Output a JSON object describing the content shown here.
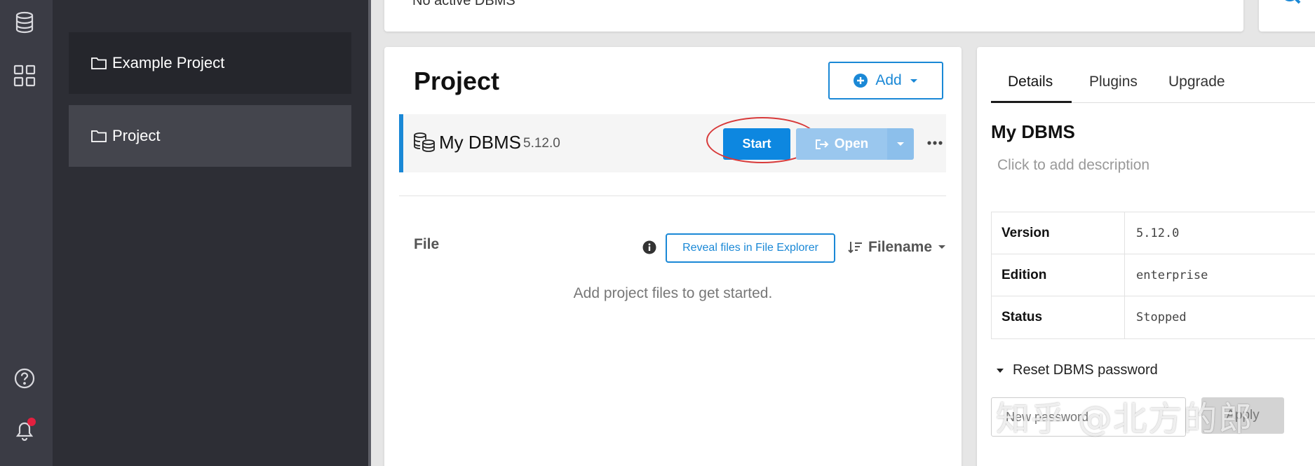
{
  "topbar": {
    "partial_text": "No active DBMS"
  },
  "sidebar": {
    "projects": [
      {
        "label": "Example Project"
      },
      {
        "label": "Project"
      }
    ]
  },
  "project": {
    "title": "Project",
    "add_label": "Add",
    "dbms": {
      "name": "My DBMS",
      "version": "5.12.0",
      "start_label": "Start",
      "open_label": "Open"
    },
    "files": {
      "label": "File",
      "reveal_label": "Reveal files in File Explorer",
      "sort_label": "Filename",
      "empty_message": "Add project files to get started."
    }
  },
  "details": {
    "tabs": [
      {
        "label": "Details"
      },
      {
        "label": "Plugins"
      },
      {
        "label": "Upgrade"
      }
    ],
    "title": "My DBMS",
    "description_placeholder": "Click to add description",
    "rows": [
      {
        "key": "Version",
        "value": "5.12.0"
      },
      {
        "key": "Edition",
        "value": "enterprise"
      },
      {
        "key": "Status",
        "value": "Stopped"
      }
    ],
    "reset_label": "Reset DBMS password",
    "password_placeholder": "New password",
    "apply_label": "Apply"
  },
  "watermark": "知乎 @北方的郎",
  "colors": {
    "accent": "#1a88d6",
    "rail_bg": "#3b3c45",
    "panel_bg": "#2d2e35",
    "highlight_ring": "#d83a3a",
    "notification": "#e3203f"
  }
}
